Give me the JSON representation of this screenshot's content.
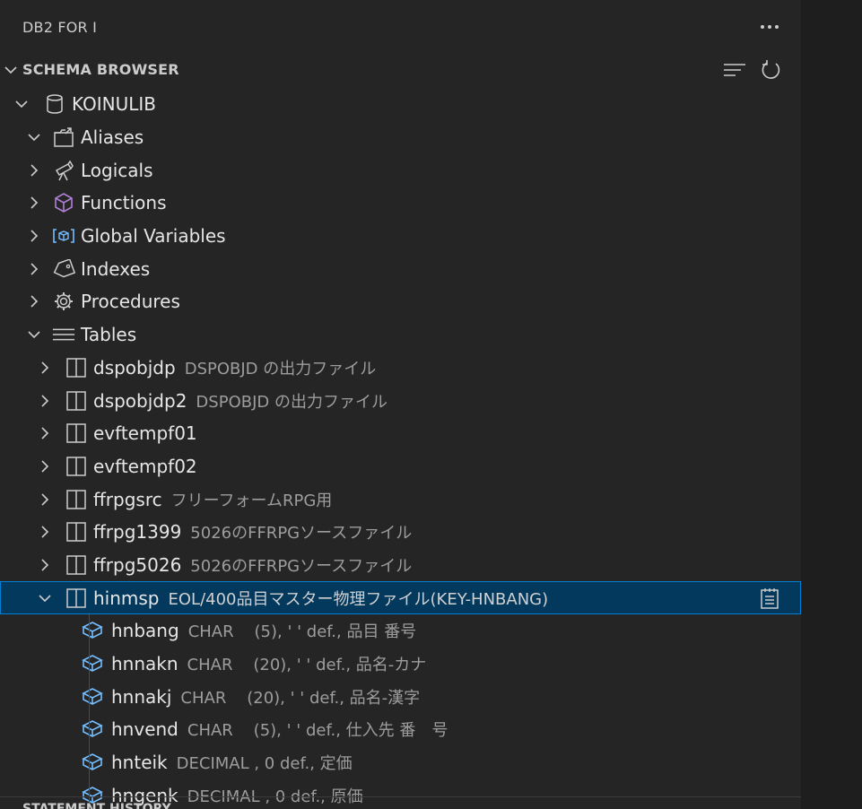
{
  "view": {
    "title": "DB2 FOR I",
    "more_icon": "ellipsis-icon"
  },
  "section": {
    "title": "SCHEMA BROWSER",
    "actions": [
      "collapse-all-icon",
      "refresh-icon"
    ]
  },
  "tree": {
    "schema": {
      "label": "KOINULIB",
      "icon": "database-icon",
      "expanded": true
    },
    "categories": [
      {
        "label": "Aliases",
        "icon": "alias-icon",
        "expanded": true
      },
      {
        "label": "Logicals",
        "icon": "telescope-icon",
        "expanded": false
      },
      {
        "label": "Functions",
        "icon": "function-cube-icon",
        "expanded": false
      },
      {
        "label": "Global Variables",
        "icon": "variable-icon",
        "expanded": false
      },
      {
        "label": "Indexes",
        "icon": "tag-icon",
        "expanded": false
      },
      {
        "label": "Procedures",
        "icon": "gear-icon",
        "expanded": false
      },
      {
        "label": "Tables",
        "icon": "list-icon",
        "expanded": true
      }
    ],
    "tables": [
      {
        "label": "dspobjdp",
        "desc": "DSPOBJD の出力ファイル"
      },
      {
        "label": "dspobjdp2",
        "desc": "DSPOBJD の出力ファイル"
      },
      {
        "label": "evftempf01",
        "desc": ""
      },
      {
        "label": "evftempf02",
        "desc": ""
      },
      {
        "label": "ffrpgsrc",
        "desc": "フリーフォームRPG用"
      },
      {
        "label": "ffrpg1399",
        "desc": "5026のFFRPGソースファイル"
      },
      {
        "label": "ffrpg5026",
        "desc": "5026のFFRPGソースファイル"
      },
      {
        "label": "hinmsp",
        "desc": "EOL/400品目マスター物理ファイル(KEY-HNBANG)",
        "selected": true,
        "expanded": true
      }
    ],
    "columns": [
      {
        "label": "hnbang",
        "desc": "CHAR    (5), ' ' def., 品目 番号"
      },
      {
        "label": "hnnakn",
        "desc": "CHAR    (20), ' ' def., 品名-カナ"
      },
      {
        "label": "hnnakj",
        "desc": "CHAR    (20), ' ' def., 品名-漢字"
      },
      {
        "label": "hnvend",
        "desc": "CHAR    (5), ' ' def., 仕入先 番　号"
      },
      {
        "label": "hnteik",
        "desc": "DECIMAL , 0 def., 定価"
      },
      {
        "label": "hngenk",
        "desc": "DECIMAL , 0 def., 原価"
      }
    ],
    "selected_row_action_icon": "notebook-icon"
  },
  "bottom_section": {
    "title": "STATEMENT HISTORY"
  },
  "colors": {
    "panel_bg": "#252526",
    "selected_bg": "#04395e",
    "selected_border": "#007fd4",
    "function_icon": "#b180d7",
    "variable_icon": "#75beff",
    "column_icon": "#75beff"
  }
}
